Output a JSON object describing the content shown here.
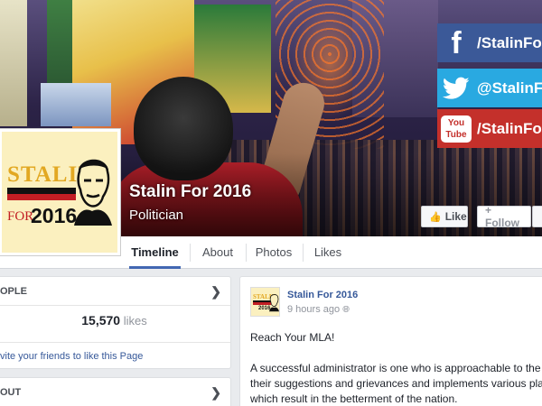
{
  "cover": {
    "social": {
      "facebook": "/StalinFor",
      "twitter": "@StalinFo",
      "youtube": "/StalinFo",
      "youtube_icon": [
        "You",
        "Tube"
      ]
    }
  },
  "page": {
    "name": "Stalin For 2016",
    "category": "Politician"
  },
  "profile_logo": {
    "word": "STALIN",
    "for": "FOR",
    "year": "2016"
  },
  "actions": {
    "like": "Like",
    "follow": "+ Follow"
  },
  "tabs": [
    {
      "label": "Timeline",
      "active": true
    },
    {
      "label": "About"
    },
    {
      "label": "Photos"
    },
    {
      "label": "Likes"
    }
  ],
  "people_card": {
    "title": "OPLE",
    "likes_count": "15,570",
    "likes_word": "likes",
    "invite": "vite your friends to like this Page"
  },
  "about_card": {
    "title": "OUT"
  },
  "post": {
    "author": "Stalin For 2016",
    "time": "9 hours ago",
    "avatar": {
      "word": "STALIN",
      "year": "2016"
    },
    "line1": "Reach Your MLA!",
    "body": "A successful administrator is one who is approachable to the their suggestions and grievances and implements various pla which result in the betterment of the nation."
  },
  "colors": {
    "facebook": "#3b5998",
    "twitter": "#29a9e1",
    "youtube": "#c4302b",
    "link": "#365899",
    "tab_active": "#4267b2"
  },
  "icons": {
    "facebook": "facebook-icon",
    "twitter": "twitter-icon",
    "youtube": "youtube-icon",
    "like": "thumbs-up-icon",
    "chevron": "chevron-right-icon",
    "globe": "globe-icon"
  }
}
